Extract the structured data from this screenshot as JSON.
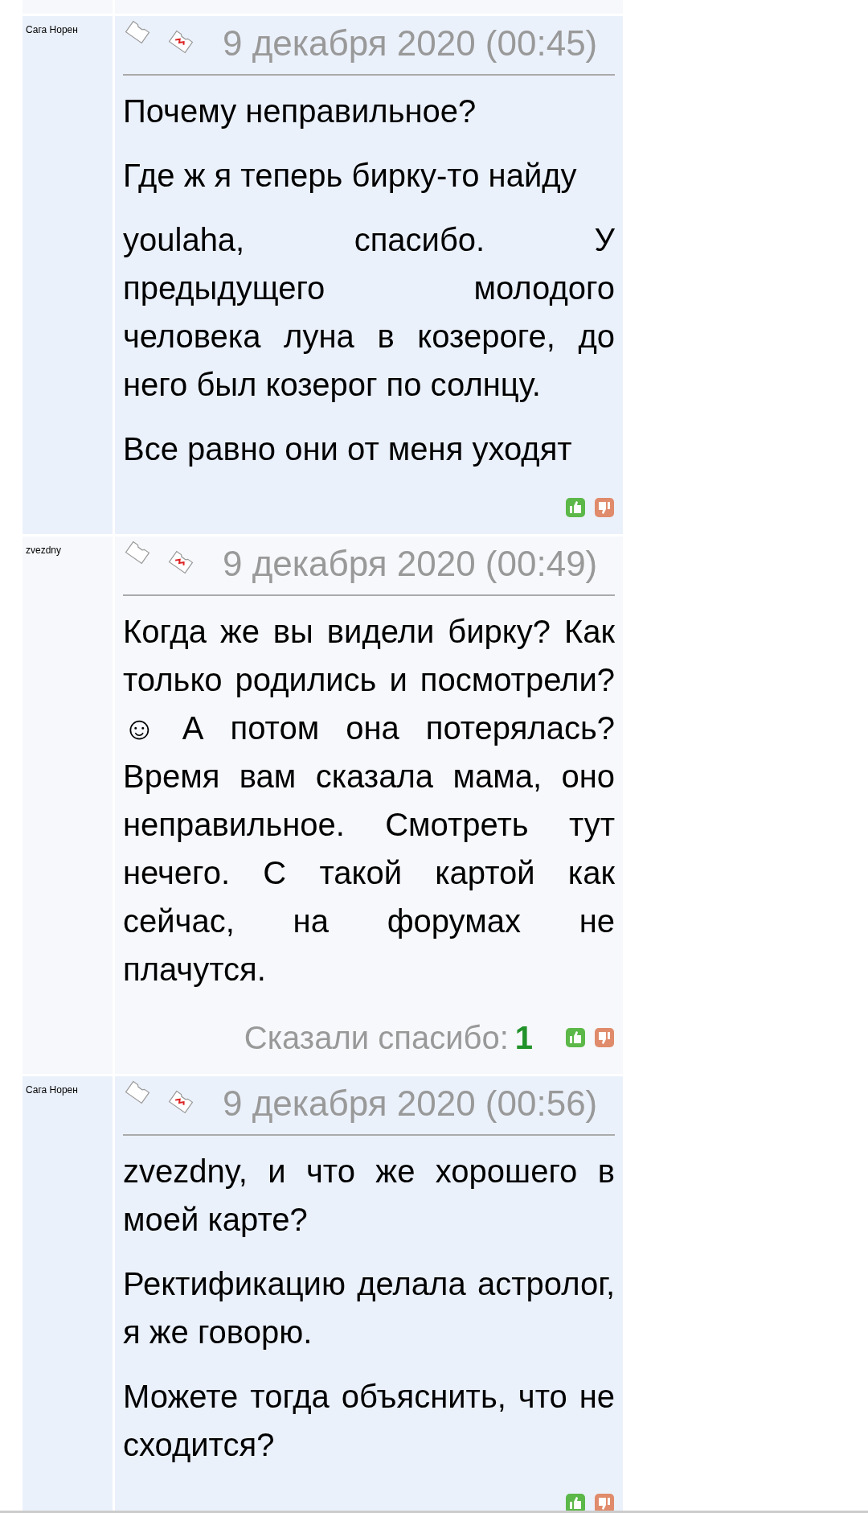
{
  "posts": [
    {
      "kind": "blue",
      "author": "Сага Норен",
      "date": "9 декабря 2020 (00:45)",
      "paragraphs": [
        {
          "segments": [
            "Почему неправильное?"
          ]
        },
        {
          "segments": [
            "Где ж я теперь бирку-то найду"
          ]
        },
        {
          "segments": [
            "youlaha, спасибо. У предыдущего молодого человека луна в козероге, до него был козерог по солнцу."
          ]
        },
        {
          "segments": [
            "Все равно они от меня уходят"
          ]
        }
      ]
    },
    {
      "kind": "grey",
      "author": "zvezdny",
      "date": "9 декабря 2020 (00:49)",
      "paragraphs": [
        {
          "segments": [
            "Когда же вы видели бирку? Как только родились и посмотрели? ☺ А потом она потерялась? Время вам сказала мама, оно неправильное. Смотреть тут нечего. С такой картой как сейчас, на форумах не плачутся."
          ]
        }
      ],
      "thanks": {
        "label": "Сказали спасибо:",
        "count": "1"
      }
    },
    {
      "kind": "blue",
      "author": "Сага Норен",
      "date": "9 декабря 2020 (00:56)",
      "paragraphs": [
        {
          "segments": [
            "zvezdny, и что же хорошего в моей карте?"
          ]
        },
        {
          "segments": [
            "Ректификацию делала астролог, я же говорю."
          ]
        },
        {
          "segments": [
            "Можете тогда объяснить, что не сходится?"
          ]
        }
      ]
    }
  ]
}
